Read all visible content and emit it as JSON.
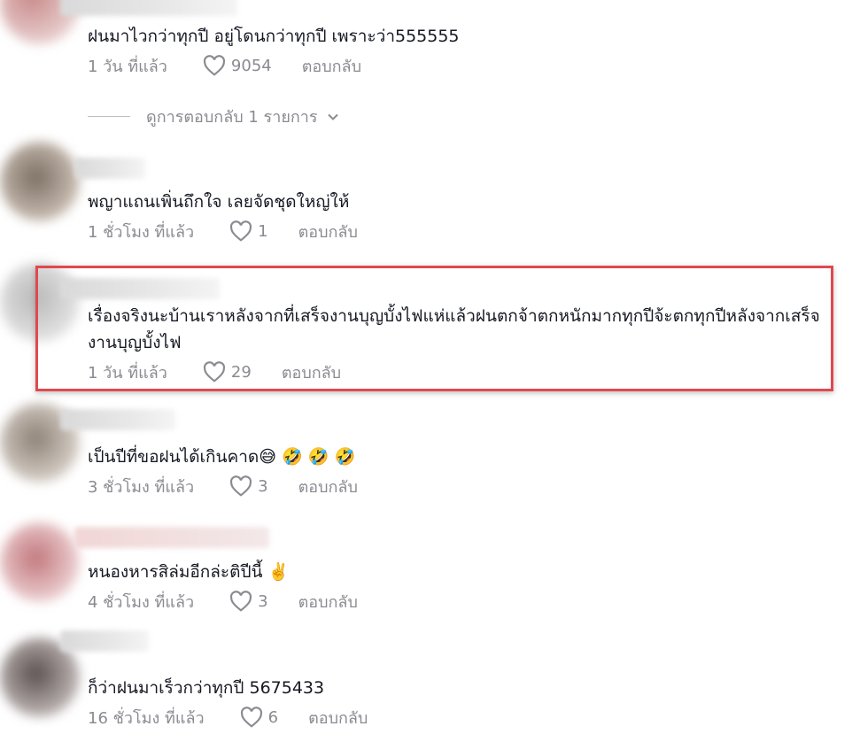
{
  "colors": {
    "highlight": "#e1484f",
    "muted": "#8a8b91",
    "text": "#161823"
  },
  "comments": [
    {
      "text": "ฝนมาไวกว่าทุกปี อยู่โดนกว่าทุกปี เพราะว่า555555",
      "time": "1 วัน ที่แล้ว",
      "likes": "9054",
      "reply": "ตอบกลับ"
    },
    {
      "text": "พญาแถนเพิ่นถึกใจ เลยจัดชุดใหญ่ให้",
      "time": "1 ชั่วโมง ที่แล้ว",
      "likes": "1",
      "reply": "ตอบกลับ"
    },
    {
      "text": "เรื่องจริงนะบ้านเราหลังจากที่เสร็จงานบุญบั้งไฟแห่แล้วฝนตกจ้าตกหนักมากทุกปีจ้ะตกทุกปีหลังจากเสร็จงานบุญบั้งไฟ",
      "time": "1 วัน ที่แล้ว",
      "likes": "29",
      "reply": "ตอบกลับ"
    },
    {
      "text": "เป็นปีที่ขอฝนได้เกินคาด",
      "emoji": "😅 🤣 🤣 🤣",
      "time": "3 ชั่วโมง ที่แล้ว",
      "likes": "3",
      "reply": "ตอบกลับ"
    },
    {
      "text": "หนองหารสิล่มอีกล่ะติปีนี้",
      "emoji": "✌️",
      "time": "4 ชั่วโมง ที่แล้ว",
      "likes": "3",
      "reply": "ตอบกลับ"
    },
    {
      "text": "ก็ว่าฝนมาเร็วกว่าทุกปี 5675433",
      "time": "16 ชั่วโมง ที่แล้ว",
      "likes": "6",
      "reply": "ตอบกลับ"
    }
  ],
  "view_replies": "ดูการตอบกลับ 1 รายการ",
  "icons": {
    "like": "heart-outline-icon",
    "chevron": "chevron-down-icon"
  }
}
